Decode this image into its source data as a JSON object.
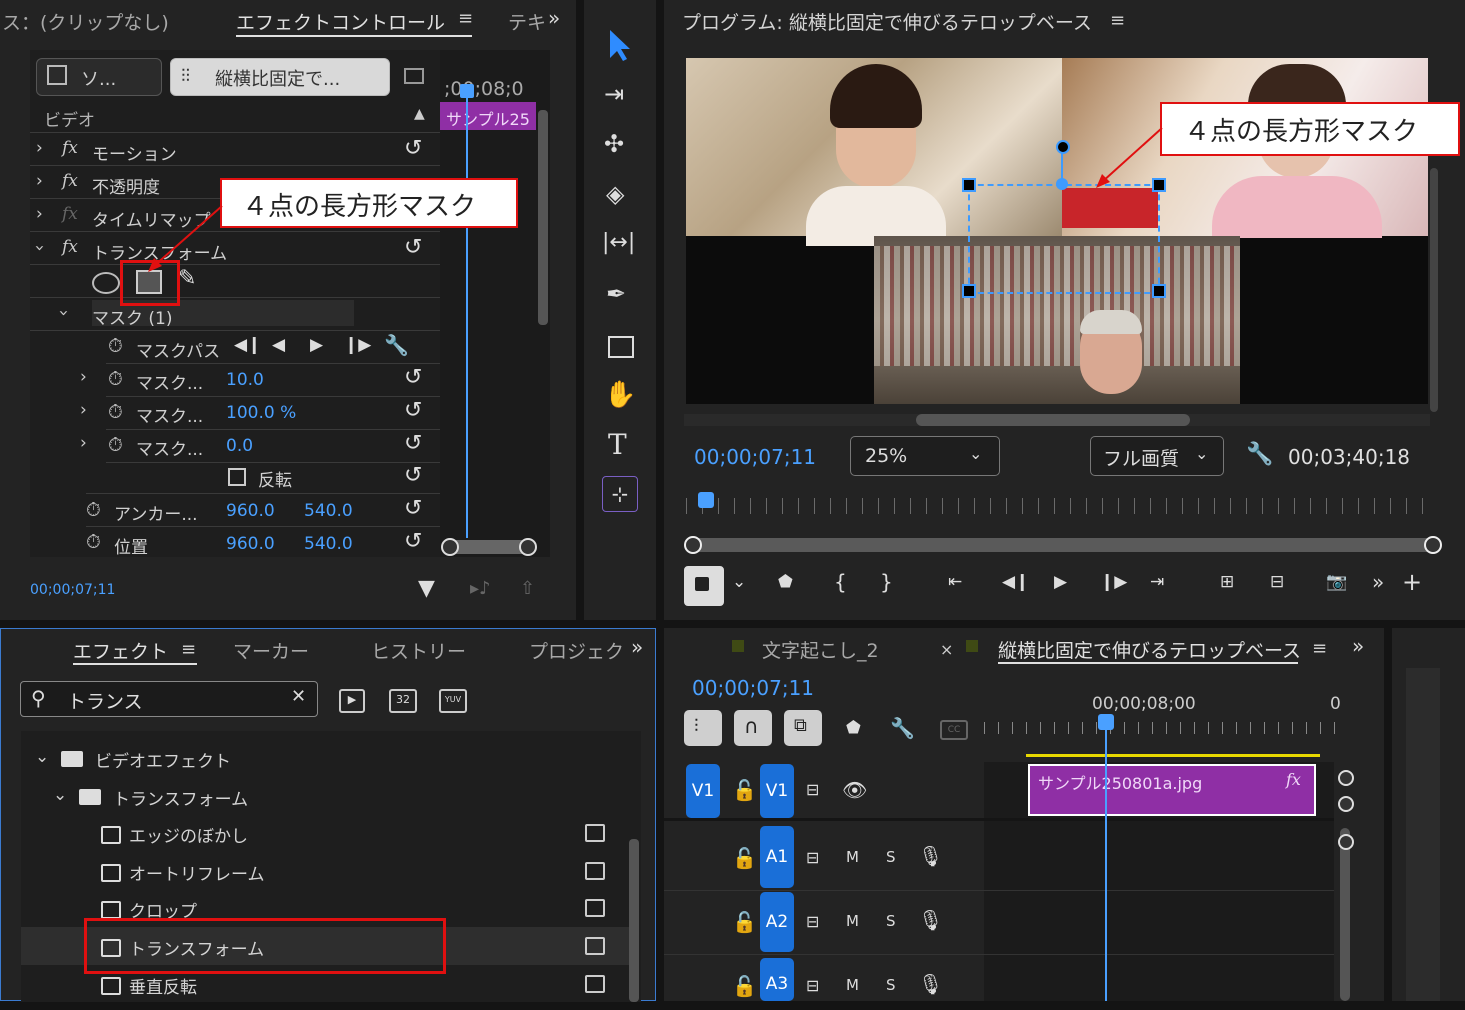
{
  "effect_controls": {
    "tab_source_partial": "ス：(クリップなし)",
    "tab_active": "エフェクトコントロール",
    "tab_next_partial": "テキ",
    "source_button": "ソ...",
    "sequence_button": "縦横比固定で...",
    "timecode_ruler": ";00;08;0",
    "clip_label": "サンプル25",
    "section_video": "ビデオ",
    "rows": [
      {
        "label": "モーション"
      },
      {
        "label": "不透明度"
      },
      {
        "label": "タイムリマップ"
      },
      {
        "label": "トランスフォーム"
      }
    ],
    "mask_label": "マスク (1)",
    "mask_path_label": "マスクパス",
    "mask_props": [
      {
        "label": "マスク...",
        "value": "10.0"
      },
      {
        "label": "マスク...",
        "value": "100.0 %"
      },
      {
        "label": "マスク...",
        "value": "0.0"
      }
    ],
    "invert_label": "反転",
    "anchor_label": "アンカー...",
    "anchor_x": "960.0",
    "anchor_y": "540.0",
    "position_label": "位置",
    "position_x": "960.0",
    "position_y": "540.0",
    "timecode": "00;00;07;11"
  },
  "program_monitor": {
    "title": "プログラム: 縦横比固定で伸びるテロップベース",
    "timecode": "00;00;07;11",
    "zoom": "25%",
    "quality": "フル画質",
    "duration": "00;03;40;18"
  },
  "effects_panel": {
    "tabs": [
      "エフェクト",
      "マーカー",
      "ヒストリー",
      "プロジェク"
    ],
    "search_value": "トランス",
    "badge_32": "32",
    "badge_yuv": "YUV",
    "tree": [
      {
        "label": "ビデオエフェクト",
        "level": 0,
        "type": "folder"
      },
      {
        "label": "トランスフォーム",
        "level": 1,
        "type": "folder"
      },
      {
        "label": "エッジのぼかし",
        "level": 2,
        "type": "effect"
      },
      {
        "label": "オートリフレーム",
        "level": 2,
        "type": "effect"
      },
      {
        "label": "クロップ",
        "level": 2,
        "type": "effect"
      },
      {
        "label": "トランスフォーム",
        "level": 2,
        "type": "effect",
        "selected": true
      },
      {
        "label": "垂直反転",
        "level": 2,
        "type": "effect"
      }
    ]
  },
  "timeline": {
    "tab1": "文字起こし_2",
    "tab2": "縦横比固定で伸びるテロップベース",
    "timecode": "00;00;07;11",
    "ruler_label": "00;00;08;00",
    "ruler_end": "0",
    "clip_name": "サンプル250801a.jpg",
    "clip_fx": "fx",
    "tracks": [
      {
        "src": "V1",
        "tgt": "V1"
      },
      {
        "tgt": "A1",
        "m": "M",
        "s": "S"
      },
      {
        "tgt": "A2",
        "m": "M",
        "s": "S"
      },
      {
        "tgt": "A3",
        "m": "M",
        "s": "S"
      }
    ]
  },
  "annotations": {
    "callout_text": "４点の長方形マスク",
    "callout_text_2": "４点の長方形マスク"
  },
  "colors": {
    "accent_blue": "#4aa0ff",
    "clip_purple": "#8f2fa5",
    "annotation_red": "#e01010"
  }
}
